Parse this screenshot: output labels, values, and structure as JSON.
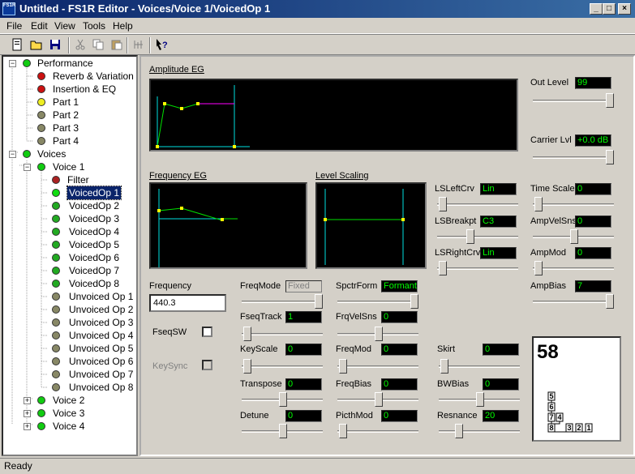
{
  "window": {
    "title": "Untitled - FS1R Editor - Voices/Voice 1/VoicedOp 1",
    "icon_text": "FS1R"
  },
  "menu": [
    "File",
    "Edit",
    "View",
    "Tools",
    "Help"
  ],
  "toolbar": [
    "new-icon",
    "open-icon",
    "save-icon",
    "cut-icon",
    "copy-icon",
    "paste-icon",
    "compare-icon",
    "help-icon"
  ],
  "tree": {
    "performance": "Performance",
    "reverb": "Reverb & Variation",
    "insertion": "Insertion & EQ",
    "part1": "Part 1",
    "part2": "Part 2",
    "part3": "Part 3",
    "part4": "Part 4",
    "voices": "Voices",
    "voice1": "Voice 1",
    "filter": "Filter",
    "vop1": "VoicedOp 1",
    "vop2": "VoicedOp 2",
    "vop3": "VoicedOp 3",
    "vop4": "VoicedOp 4",
    "vop5": "VoicedOp 5",
    "vop6": "VoicedOp 6",
    "vop7": "VoicedOp 7",
    "vop8": "VoicedOp 8",
    "uop1": "Unvoiced Op 1",
    "uop2": "Unvoiced Op 2",
    "uop3": "Unvoiced Op 3",
    "uop4": "Unvoiced Op 4",
    "uop5": "Unvoiced Op 5",
    "uop6": "Unvoiced Op 6",
    "uop7": "Unvoiced Op 7",
    "uop8": "Unvoiced Op 8",
    "voice2": "Voice 2",
    "voice3": "Voice 3",
    "voice4": "Voice 4"
  },
  "panel": {
    "amp_eg": "Amplitude EG",
    "freq_eg": "Frequency EG",
    "level_scaling": "Level Scaling",
    "out_level_label": "Out Level",
    "out_level": "99",
    "carrier_lvl_label": "Carrier Lvl",
    "carrier_lvl": "+0.0 dB",
    "lsleft_label": "LSLeftCrv",
    "lsleft": "Lin",
    "lsbreak_label": "LSBreakpt",
    "lsbreak": "C3",
    "lsright_label": "LSRightCrv",
    "lsright": "Lin",
    "timescale_label": "Time Scale",
    "timescale": "0",
    "ampvelsns_label": "AmpVelSns",
    "ampvelsns": "0",
    "ampmod_label": "AmpMod",
    "ampmod": "0",
    "ampbias_label": "AmpBias",
    "ampbias": "7",
    "frequency_label": "Frequency",
    "frequency": "440.3",
    "fseqsw_label": "FseqSW",
    "keysync_label": "KeySync",
    "freqmode_label": "FreqMode",
    "freqmode": "Fixed",
    "spctrform_label": "SpctrForm",
    "spctrform": "Formant",
    "fseqtrack_label": "FseqTrack",
    "fseqtrack": "1",
    "frqvelsns_label": "FrqVelSns",
    "frqvelsns": "0",
    "keyscale_label": "KeyScale",
    "keyscale": "0",
    "freqmod_label": "FreqMod",
    "freqmod": "0",
    "skirt_label": "Skirt",
    "skirt": "0",
    "transpose_label": "Transpose",
    "transpose": "0",
    "freqbias_label": "FreqBias",
    "freqbias": "0",
    "bwbias_label": "BWBias",
    "bwbias": "0",
    "detune_label": "Detune",
    "detune": "0",
    "picthmod_label": "PicthMod",
    "picthmod": "0",
    "resnance_label": "Resnance",
    "resnance": "20",
    "algorithm_number": "58",
    "algo_ops": [
      "5",
      "6",
      "7",
      "4",
      "3",
      "8",
      "2",
      "1"
    ]
  },
  "status": "Ready",
  "colors": {
    "title_start": "#0a246a",
    "title_end": "#3a6ea5",
    "display_bg": "#000000",
    "value_text": "#00ff00",
    "eg_line": "#00e0e0",
    "eg_point": "#ffff00",
    "eg_sustain": "#ff00ff"
  }
}
